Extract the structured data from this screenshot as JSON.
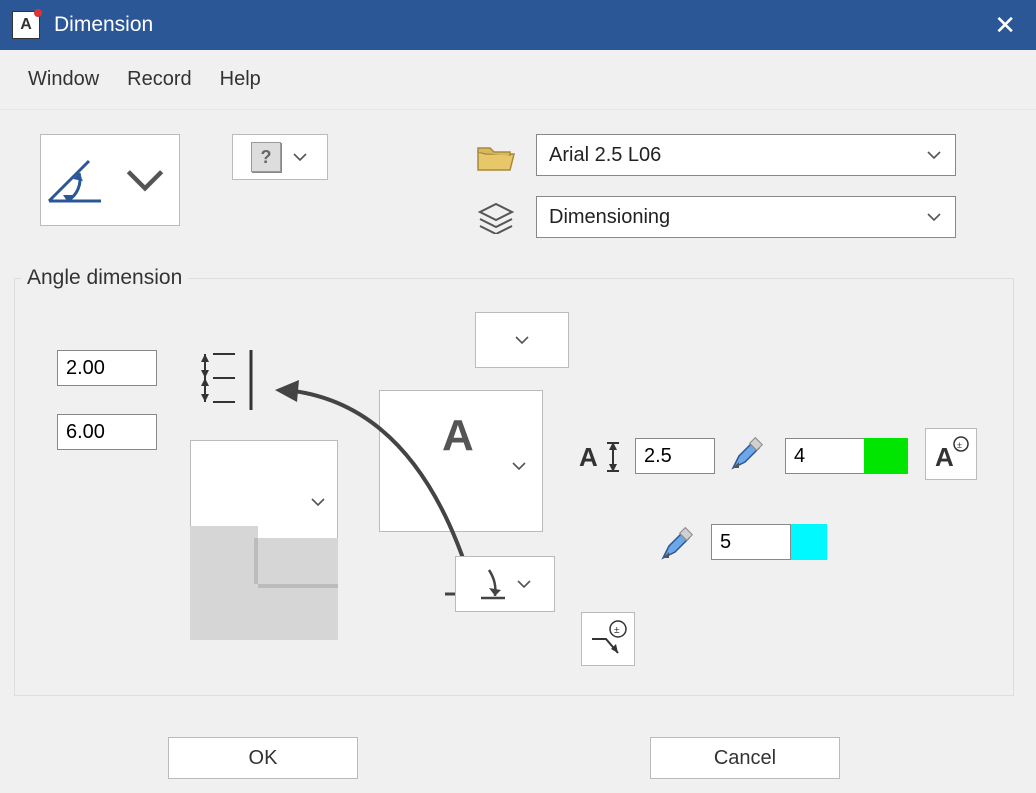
{
  "window": {
    "title": "Dimension"
  },
  "menu": {
    "window": "Window",
    "record": "Record",
    "help": "Help"
  },
  "font_combo": "Arial 2.5 L06",
  "layer_combo": "Dimensioning",
  "group_label": "Angle dimension",
  "inputs": {
    "extension_over": "2.00",
    "extension_offset": "6.00",
    "text_height": "2.5",
    "pen_width_text": "4",
    "pen_width_line": "5"
  },
  "colors": {
    "text_color": "#00e600",
    "line_color": "#00f8ff"
  },
  "buttons": {
    "ok": "OK",
    "cancel": "Cancel"
  }
}
